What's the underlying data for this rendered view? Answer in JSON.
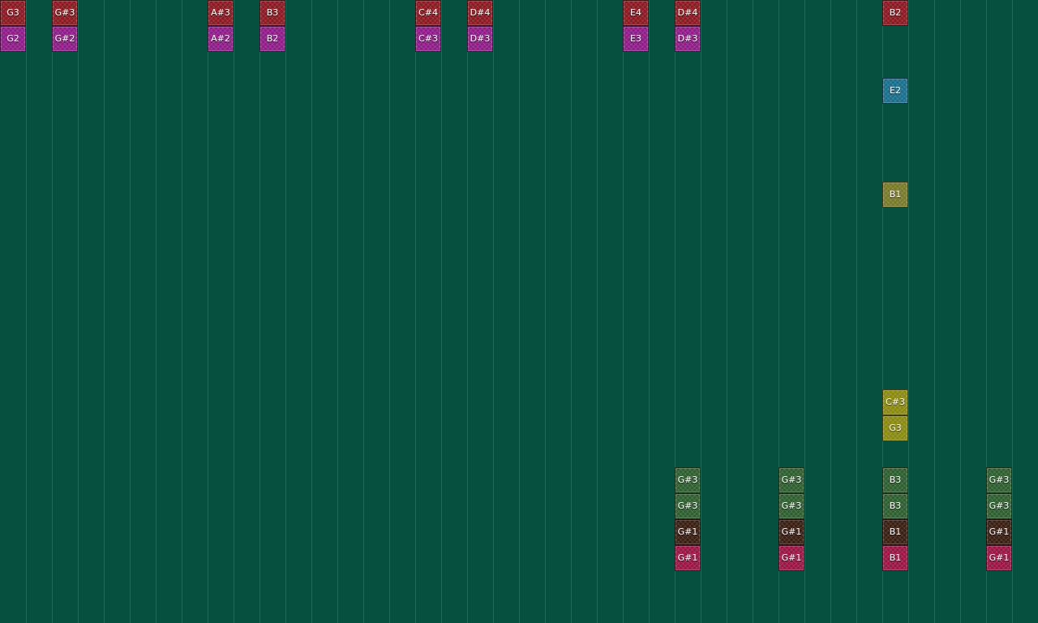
{
  "colors": {
    "background": "#05503e",
    "grid_line": "#1f6b58",
    "red": "#8b1a22",
    "purple": "#8e1d88",
    "blue": "#1b6e8c",
    "olive": "#7a7a2c",
    "yellow": "#8a8a12",
    "green": "#2f5f30",
    "brown": "#3a1e12",
    "crimson": "#9a1645"
  },
  "notes": [
    {
      "label": "G3",
      "col": 0,
      "row": 0,
      "color": "red"
    },
    {
      "label": "G2",
      "col": 0,
      "row": 1,
      "color": "purple"
    },
    {
      "label": "G#3",
      "col": 2,
      "row": 0,
      "color": "red"
    },
    {
      "label": "G#2",
      "col": 2,
      "row": 1,
      "color": "purple"
    },
    {
      "label": "A#3",
      "col": 8,
      "row": 0,
      "color": "red"
    },
    {
      "label": "A#2",
      "col": 8,
      "row": 1,
      "color": "purple"
    },
    {
      "label": "B3",
      "col": 10,
      "row": 0,
      "color": "red"
    },
    {
      "label": "B2",
      "col": 10,
      "row": 1,
      "color": "purple"
    },
    {
      "label": "C#4",
      "col": 16,
      "row": 0,
      "color": "red"
    },
    {
      "label": "C#3",
      "col": 16,
      "row": 1,
      "color": "purple"
    },
    {
      "label": "D#4",
      "col": 18,
      "row": 0,
      "color": "red"
    },
    {
      "label": "D#3",
      "col": 18,
      "row": 1,
      "color": "purple"
    },
    {
      "label": "E4",
      "col": 24,
      "row": 0,
      "color": "red"
    },
    {
      "label": "E3",
      "col": 24,
      "row": 1,
      "color": "purple"
    },
    {
      "label": "D#4",
      "col": 26,
      "row": 0,
      "color": "red"
    },
    {
      "label": "D#3",
      "col": 26,
      "row": 1,
      "color": "purple"
    },
    {
      "label": "B2",
      "col": 34,
      "row": 0,
      "color": "red"
    },
    {
      "label": "E2",
      "col": 34,
      "row": 3,
      "color": "blue"
    },
    {
      "label": "B1",
      "col": 34,
      "row": 7,
      "color": "olive"
    },
    {
      "label": "C#3",
      "col": 34,
      "row": 15,
      "color": "yellow"
    },
    {
      "label": "G3",
      "col": 34,
      "row": 16,
      "color": "yellow"
    },
    {
      "label": "G#3",
      "col": 26,
      "row": 18,
      "color": "green"
    },
    {
      "label": "G#3",
      "col": 26,
      "row": 19,
      "color": "green"
    },
    {
      "label": "G#1",
      "col": 26,
      "row": 20,
      "color": "brown"
    },
    {
      "label": "G#1",
      "col": 26,
      "row": 21,
      "color": "crimson"
    },
    {
      "label": "G#3",
      "col": 30,
      "row": 18,
      "color": "green"
    },
    {
      "label": "G#3",
      "col": 30,
      "row": 19,
      "color": "green"
    },
    {
      "label": "G#1",
      "col": 30,
      "row": 20,
      "color": "brown"
    },
    {
      "label": "G#1",
      "col": 30,
      "row": 21,
      "color": "crimson"
    },
    {
      "label": "B3",
      "col": 34,
      "row": 18,
      "color": "green"
    },
    {
      "label": "B3",
      "col": 34,
      "row": 19,
      "color": "green"
    },
    {
      "label": "B1",
      "col": 34,
      "row": 20,
      "color": "brown"
    },
    {
      "label": "B1",
      "col": 34,
      "row": 21,
      "color": "crimson"
    },
    {
      "label": "G#3",
      "col": 38,
      "row": 18,
      "color": "green"
    },
    {
      "label": "G#3",
      "col": 38,
      "row": 19,
      "color": "green"
    },
    {
      "label": "G#1",
      "col": 38,
      "row": 20,
      "color": "brown"
    },
    {
      "label": "G#1",
      "col": 38,
      "row": 21,
      "color": "crimson"
    }
  ]
}
